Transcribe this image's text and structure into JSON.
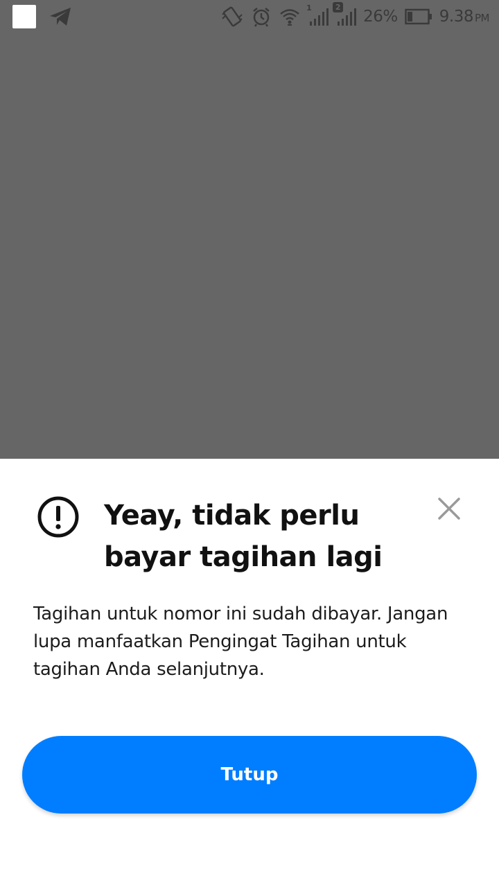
{
  "status_bar": {
    "battery_percent": "26%",
    "time": "9.38",
    "time_suffix": "PM",
    "sim1_label": "1",
    "sim2_label": "2",
    "icons": [
      "notification-square-icon",
      "telegram-icon",
      "vibrate-icon",
      "alarm-icon",
      "wifi-icon",
      "signal-sim1-icon",
      "signal-sim2-icon",
      "battery-icon"
    ]
  },
  "sheet": {
    "icon": "alert-circle-icon",
    "title": "Yeay, tidak perlu bayar tagihan lagi",
    "message": "Tagihan untuk nomor ini sudah dibayar. Jangan lupa manfaatkan Pengingat Tagihan untuk tagihan Anda selanjutnya.",
    "primary_button": "Tutup"
  },
  "colors": {
    "scrim": "#666666",
    "primary": "#007eff",
    "title_text": "#111111",
    "close_icon": "#9a9a9a"
  }
}
